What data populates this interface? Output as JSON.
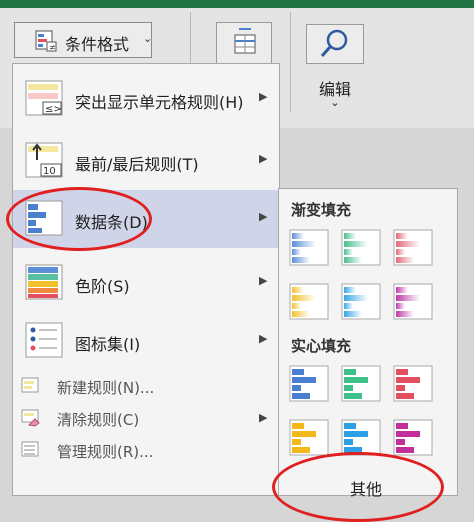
{
  "ribbon": {
    "conditional_format_label": "条件格式",
    "edit_label": "编辑"
  },
  "menu": {
    "items": [
      {
        "label": "突出显示单元格规则(H)"
      },
      {
        "label": "最前/最后规则(T)"
      },
      {
        "label": "数据条(D)"
      },
      {
        "label": "色阶(S)"
      },
      {
        "label": "图标集(I)"
      }
    ],
    "small_items": [
      {
        "label": "新建规则(N)..."
      },
      {
        "label": "清除规则(C)"
      },
      {
        "label": "管理规则(R)..."
      }
    ]
  },
  "submenu": {
    "gradient_title": "渐变填充",
    "solid_title": "实心填充",
    "gradient_colors": [
      "#5b8ed6",
      "#48c08f",
      "#e26a7a",
      "#f2c12e",
      "#38a8e6",
      "#c03aaa"
    ],
    "solid_colors": [
      "#4a7fd0",
      "#3fbf8a",
      "#e2505f",
      "#f2b81a",
      "#2f9fe8",
      "#c42e9a"
    ],
    "other_label": "其他"
  },
  "colors": {
    "title_bar": "#217346",
    "highlight": "#d0d4e8",
    "annotation": "#e02020"
  }
}
